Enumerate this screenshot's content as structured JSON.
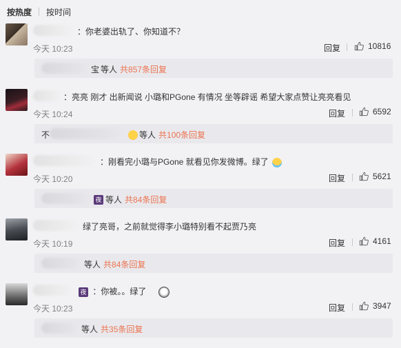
{
  "sort_tabs": [
    {
      "label": "按热度"
    },
    {
      "label": "按时间"
    }
  ],
  "comments": [
    {
      "text": "：你老婆出轨了、你知道不？",
      "time": "今天 10:23",
      "reply": "回复",
      "likes": "10816",
      "sub": {
        "trail": "宝",
        "users_label": "等人",
        "link": "共857条回复"
      }
    },
    {
      "text": "：亮亮 刚才 出新闻说 小璐和PGone 有情况 坐等辟谣 希望大家点赞让亮亮看见",
      "time": "今天 10:24",
      "reply": "回复",
      "likes": "6592",
      "sub": {
        "lead": "不",
        "users_label": "等人",
        "link": "共100条回复"
      }
    },
    {
      "text": "：刚看完小璐与PGone 就看见你发微博。绿了",
      "time": "今天 10:20",
      "reply": "回复",
      "likes": "5621",
      "sub": {
        "users_label": "等人",
        "link": "共84条回复"
      }
    },
    {
      "text": "绿了亮哥，之前就觉得李小璐特别看不起贾乃亮",
      "time": "今天 10:19",
      "reply": "回复",
      "likes": "4161",
      "sub": {
        "users_label": "等人",
        "link": "共84条回复"
      }
    },
    {
      "text": "：你被。。绿了",
      "time": "今天 10:23",
      "reply": "回复",
      "likes": "3947",
      "sub": {
        "users_label": "等人",
        "link": "共35条回复"
      }
    }
  ]
}
